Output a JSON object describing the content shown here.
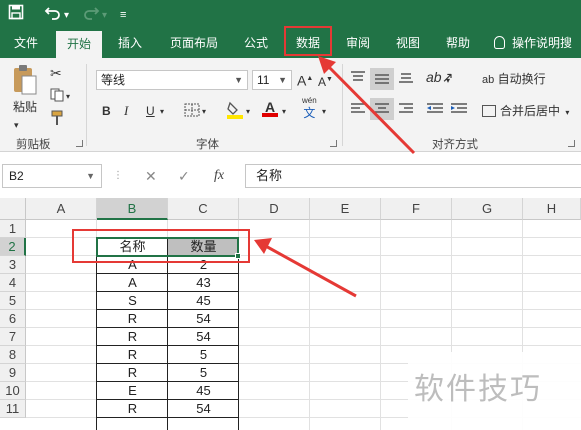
{
  "quick_access": {
    "save_icon": "save-icon",
    "undo_icon": "undo-icon",
    "redo_icon": "redo-icon",
    "customize_icon": "customize-icon"
  },
  "tabs": [
    {
      "label": "文件",
      "active": false
    },
    {
      "label": "开始",
      "active": true
    },
    {
      "label": "插入",
      "active": false
    },
    {
      "label": "页面布局",
      "active": false
    },
    {
      "label": "公式",
      "active": false
    },
    {
      "label": "数据",
      "active": false
    },
    {
      "label": "审阅",
      "active": false
    },
    {
      "label": "视图",
      "active": false
    },
    {
      "label": "帮助",
      "active": false
    },
    {
      "label": "操作说明搜",
      "active": false
    }
  ],
  "ribbon": {
    "clipboard": {
      "paste_label": "粘贴",
      "group_label": "剪贴板"
    },
    "font": {
      "font_name": "等线",
      "font_size": "11",
      "grow_label": "A",
      "shrink_label": "A",
      "bold": "B",
      "italic": "I",
      "underline": "U",
      "font_color_label": "A",
      "phonetic_top": "wén",
      "phonetic_bottom": "文",
      "group_label": "字体"
    },
    "alignment": {
      "wrap_label": "自动换行",
      "wrap_prefix": "ab",
      "merge_label": "合并后居中",
      "group_label": "对齐方式"
    }
  },
  "formula_bar": {
    "name_box": "B2",
    "fx_label": "fx",
    "content": "名称"
  },
  "columns": [
    "A",
    "B",
    "C",
    "D",
    "E",
    "F",
    "G",
    "H"
  ],
  "rows": [
    "1",
    "2",
    "3",
    "4",
    "5",
    "6",
    "7",
    "8",
    "9",
    "10",
    "11"
  ],
  "table": {
    "headers": [
      "名称",
      "数量"
    ],
    "rows": [
      [
        "A",
        "2"
      ],
      [
        "A",
        "43"
      ],
      [
        "S",
        "45"
      ],
      [
        "R",
        "54"
      ],
      [
        "R",
        "54"
      ],
      [
        "R",
        "5"
      ],
      [
        "R",
        "5"
      ],
      [
        "E",
        "45"
      ],
      [
        "R",
        "54"
      ]
    ]
  },
  "annotation_color": "#e53935",
  "accent_color": "#217346",
  "watermark": "软件技巧"
}
